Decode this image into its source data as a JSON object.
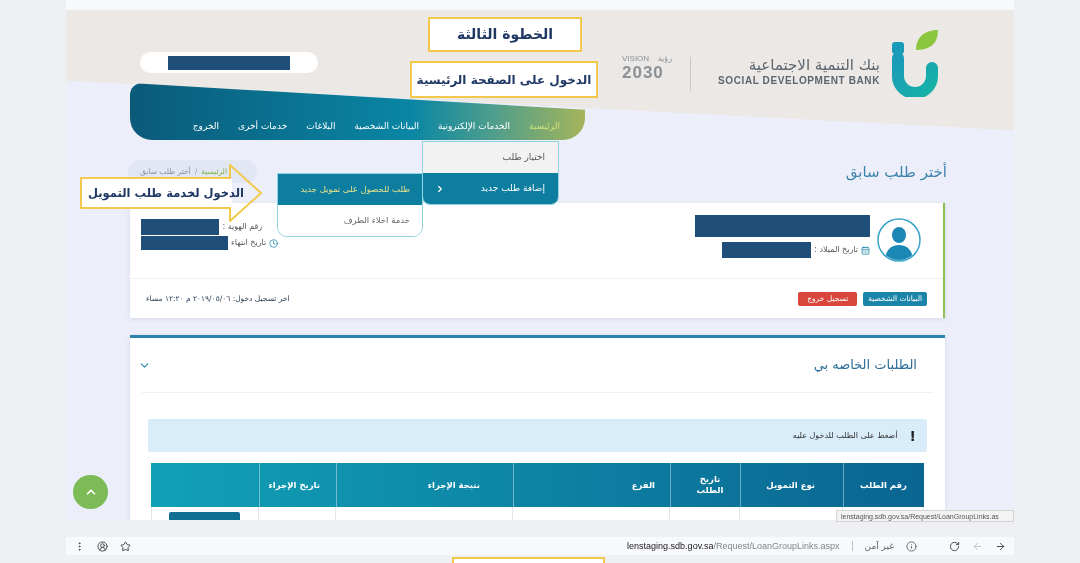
{
  "callouts": [
    {
      "kind": "box",
      "text": "الخطوة الثالثة"
    },
    {
      "kind": "box",
      "text": "الدخول على الصفحة الرئيسية"
    },
    {
      "kind": "arrow",
      "text": "الدخول لخدمة طلب التمويل"
    }
  ],
  "header": {
    "vision": {
      "word": "VISION",
      "word_ar": "رؤية",
      "year": "2030"
    },
    "bank": {
      "name_ar": "بنك التنمية الاجتماعية",
      "name_en": "SOCIAL DEVELOPMENT BANK"
    }
  },
  "nav": {
    "items": [
      {
        "label": "الرئيسية",
        "selected": true
      },
      {
        "label": "الخدمات الإلكترونية",
        "selected": false,
        "menu": [
          {
            "label": "اختيار طلب",
            "selected": false
          },
          {
            "label": "إضافة طلب جديد",
            "selected": true,
            "submenu": [
              {
                "label": "طلب للحصول على تمويل جديد",
                "selected": true
              },
              {
                "label": "خدمة اخلاء الطرف",
                "selected": false
              }
            ]
          }
        ]
      },
      {
        "label": "البيانات الشخصية",
        "selected": false
      },
      {
        "label": "البلاغات",
        "selected": false
      },
      {
        "label": "خدمات أخرى",
        "selected": false
      },
      {
        "label": "الخروج",
        "selected": false
      }
    ]
  },
  "breadcrumb": {
    "separator": "/",
    "items": [
      {
        "label": "الرئيسية",
        "kind": "link"
      },
      {
        "label": "أختر طلب سابق",
        "kind": "current"
      }
    ]
  },
  "page_title": "أختر طلب سابق",
  "profile": {
    "birth_date_label": "تاريخ الميلاد :",
    "id_label": "رقم الهوية :",
    "expiry_label": "تاريخ انتهاء",
    "buttons": [
      {
        "label": "البيانات الشخصية",
        "kind": "primary"
      },
      {
        "label": "تسجيل خروج",
        "kind": "danger"
      }
    ],
    "last_login": "اخر تسجيل دخول: ٢٠١٩/٠٥/٠٦ م ١٢:٢٠ مساء"
  },
  "requests": {
    "title": "الطلبات الخاصه بي",
    "expanded": true,
    "alert": {
      "mark": "!",
      "text": "أضغط على الطلب للدخول عليه"
    },
    "table": {
      "columns": [
        "رقم الطلب",
        "نوع التمويل",
        "تاريخ الطلب",
        "الفرع",
        "نتيجة الإجراء",
        "تاريخ الإجراء"
      ]
    }
  },
  "status_tooltip": "lenstaging.sdb.gov.sa/Request/LoanGroupLinks.as",
  "browser_bottom": {
    "domain": "lenstaging.sdb.gov.sa",
    "path": "/Request/LoanGroupLinks.aspx",
    "security": "غير آمن"
  }
}
